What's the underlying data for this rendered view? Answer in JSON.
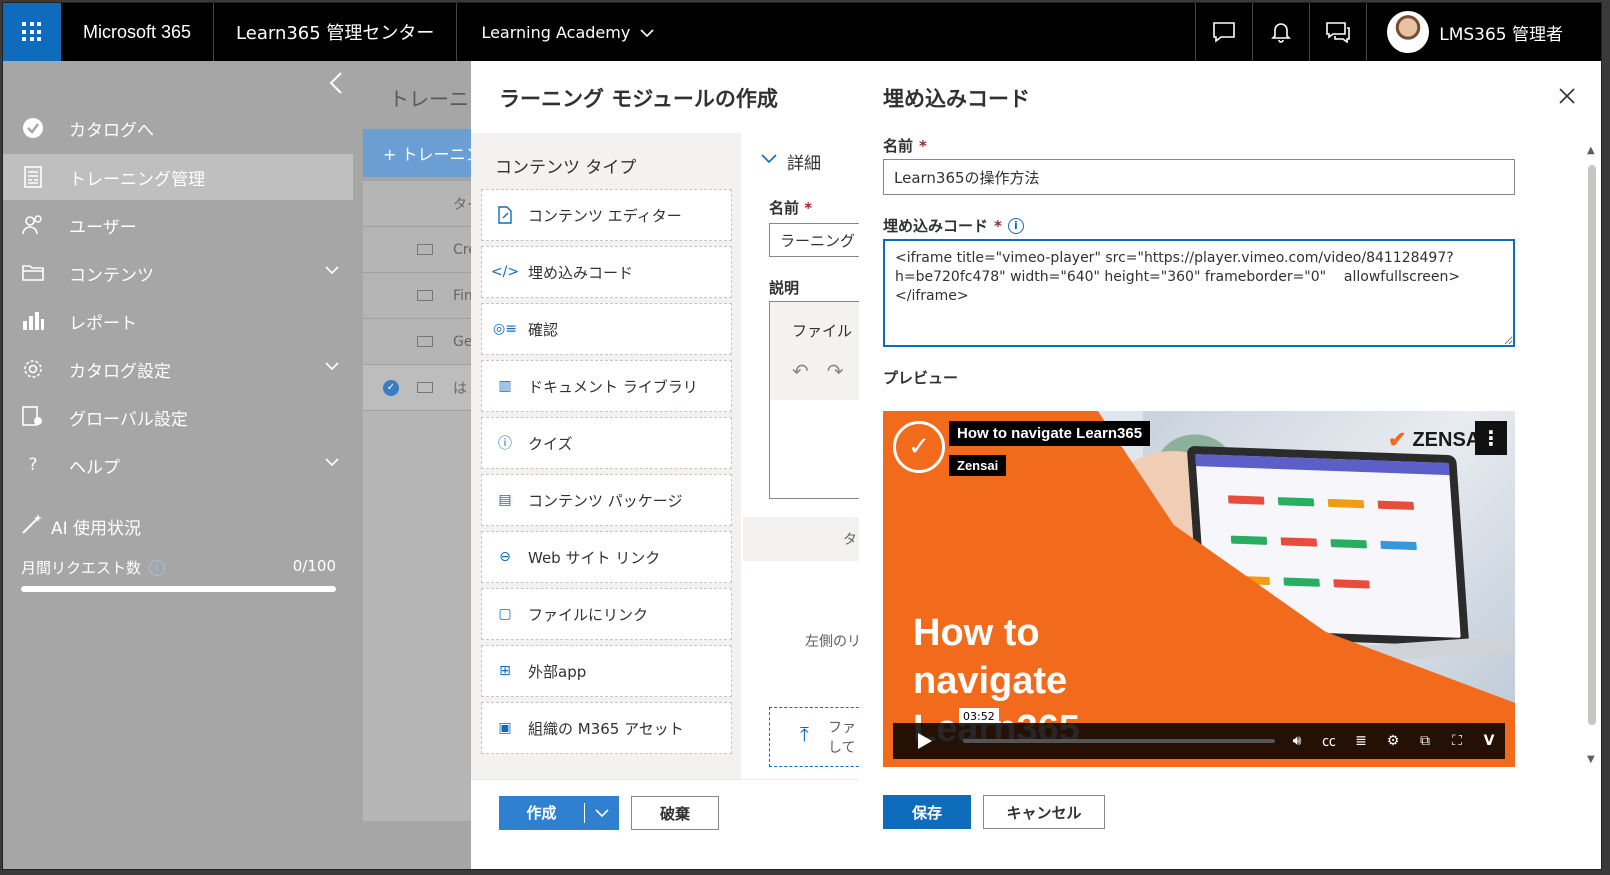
{
  "topbar": {
    "brand": "Microsoft 365",
    "app_title": "Learn365 管理センター",
    "tenant": "Learning Academy",
    "user_name": "LMS365 管理者"
  },
  "leftnav": {
    "items": [
      {
        "label": "カタログへ",
        "icon": "check-circle-icon"
      },
      {
        "label": "トレーニング管理",
        "icon": "training-icon",
        "active": true
      },
      {
        "label": "ユーザー",
        "icon": "users-icon"
      },
      {
        "label": "コンテンツ",
        "icon": "folder-icon",
        "expandable": true
      },
      {
        "label": "レポート",
        "icon": "chart-icon"
      },
      {
        "label": "カタログ設定",
        "icon": "gear-icon",
        "expandable": true
      },
      {
        "label": "グローバル設定",
        "icon": "global-settings-icon"
      },
      {
        "label": "ヘルプ",
        "icon": "help-icon",
        "expandable": true
      }
    ],
    "ai_usage": "AI 使用状況",
    "monthly_requests_label": "月間リクエスト数",
    "monthly_requests_value": "0/100"
  },
  "background_page": {
    "title": "トレーニング管理",
    "new_button": "+ トレーニング",
    "header_col": "タイ",
    "rows": [
      "Cre",
      "Fin",
      "Ge",
      "は"
    ]
  },
  "create_module": {
    "title": "ラーニング モジュールの作成",
    "content_type_title": "コンテンツ タイプ",
    "content_types": [
      {
        "label": "コンテンツ エディター",
        "icon": "edit-document-icon"
      },
      {
        "label": "埋め込みコード",
        "icon": "code-icon"
      },
      {
        "label": "確認",
        "icon": "checklist-icon"
      },
      {
        "label": "ドキュメント ライブラリ",
        "icon": "library-icon"
      },
      {
        "label": "クイズ",
        "icon": "quiz-icon"
      },
      {
        "label": "コンテンツ パッケージ",
        "icon": "package-icon"
      },
      {
        "label": "Web サイト リンク",
        "icon": "link-icon"
      },
      {
        "label": "ファイルにリンク",
        "icon": "file-link-icon"
      },
      {
        "label": "外部app",
        "icon": "app-icon"
      },
      {
        "label": "組織の M365 アセット",
        "icon": "asset-icon"
      }
    ],
    "details_header": "詳細",
    "name_label": "名前",
    "name_value": "ラーニング モジュール",
    "description_label": "説明",
    "editor_toolbar_text": "ファイル",
    "tab_fragment": "タ",
    "hint_text": "左側のリ",
    "upload_line1": "ファ",
    "upload_line2": "して",
    "create_button": "作成",
    "discard_button": "破棄"
  },
  "embed_panel": {
    "title": "埋め込みコード",
    "name_label": "名前",
    "name_value": "Learn365の操作方法",
    "code_label": "埋め込みコード",
    "code_value": "<iframe title=\"vimeo-player\" src=\"https://player.vimeo.com/video/841128497?h=be720fc478\" width=\"640\" height=\"360\" frameborder=\"0\"    allowfullscreen></iframe>",
    "preview_label": "プレビュー",
    "save_button": "保存",
    "cancel_button": "キャンセル"
  },
  "video": {
    "title": "How to navigate Learn365",
    "author": "Zensai",
    "brand": "ZENSAI",
    "overlay_title_line1": "How to",
    "overlay_title_line2": "navigate",
    "overlay_title_line3": "Learn365",
    "timestamp": "03:52",
    "accent_color": "#f26a1b"
  }
}
